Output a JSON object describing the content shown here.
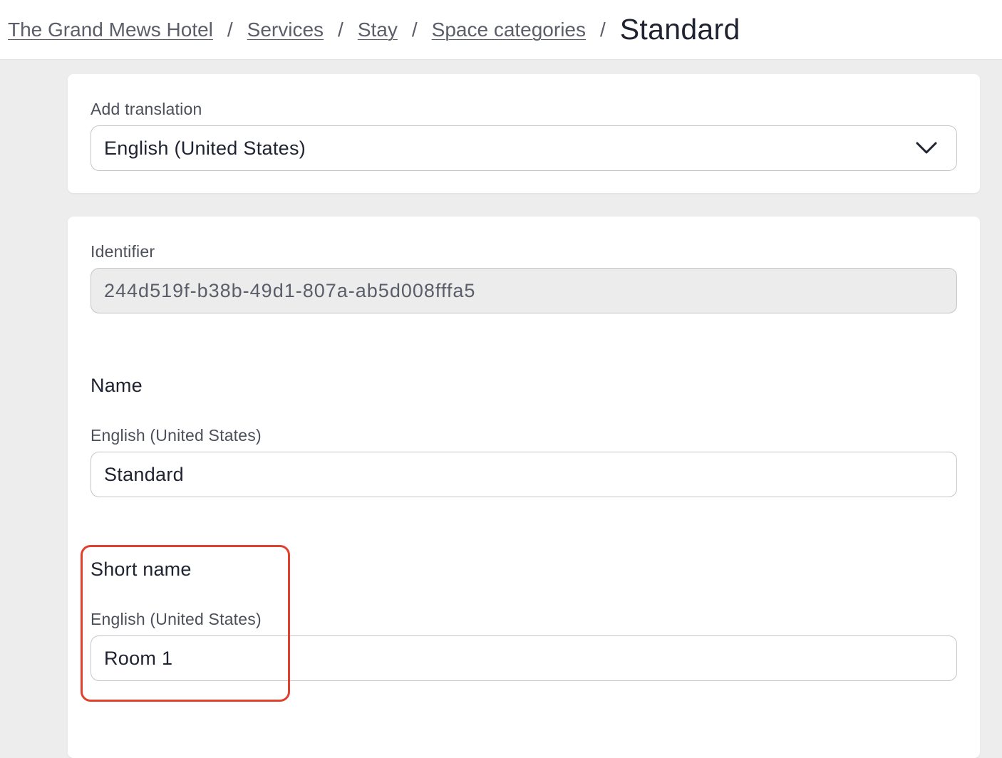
{
  "breadcrumb": {
    "items": [
      "The Grand Mews Hotel",
      "Services",
      "Stay",
      "Space categories"
    ],
    "separator": "/",
    "current": "Standard"
  },
  "translation": {
    "label": "Add translation",
    "selected": "English (United States)",
    "icon": "chevron-down-icon"
  },
  "identifier": {
    "label": "Identifier",
    "value": "244d519f-b38b-49d1-807a-ab5d008fffa5"
  },
  "name_section": {
    "title": "Name",
    "language_label": "English (United States)",
    "value": "Standard"
  },
  "short_name_section": {
    "title": "Short name",
    "language_label": "English (United States)",
    "value": "Room 1"
  },
  "colors": {
    "highlight": "#e2402d",
    "background": "#ededee",
    "card": "#ffffff"
  }
}
